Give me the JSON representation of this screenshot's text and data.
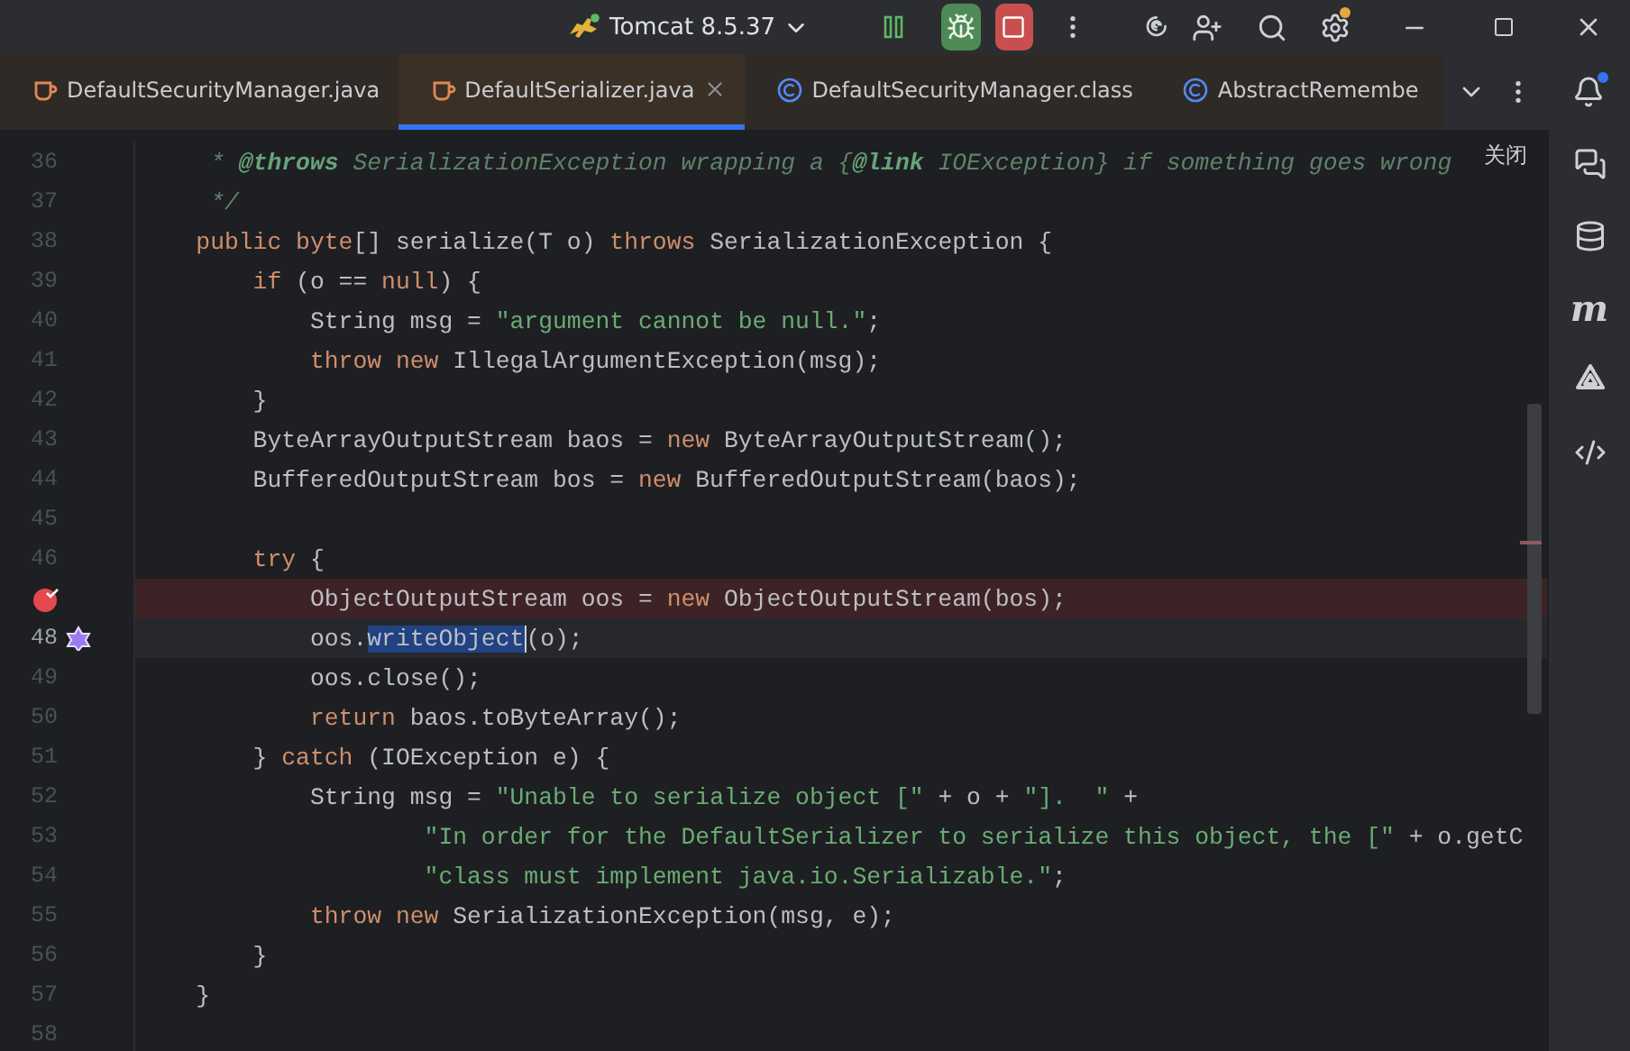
{
  "toolbar": {
    "run_config": "Tomcat 8.5.37"
  },
  "tabs": [
    {
      "label": "DefaultSecurityManager.java",
      "kind": "java",
      "selected": false
    },
    {
      "label": "DefaultSerializer.java",
      "kind": "java",
      "selected": true
    },
    {
      "label": "DefaultSecurityManager.class",
      "kind": "class",
      "selected": false
    },
    {
      "label": "AbstractRemembe",
      "kind": "class",
      "selected": false
    }
  ],
  "close_hint": "关闭",
  "side_tools": {
    "maven_glyph": "m"
  },
  "editor": {
    "lines": [
      {
        "number": "36",
        "breakpoint": false,
        "current": false,
        "segments": [
          {
            "kind": "doc",
            "text": "     * "
          },
          {
            "kind": "doc-tag",
            "text": "@throws"
          },
          {
            "kind": "doc",
            "text": " SerializationException wrapping a {"
          },
          {
            "kind": "doc-tag",
            "text": "@link"
          },
          {
            "kind": "doc",
            "text": " IOException} if something goes wrong"
          }
        ]
      },
      {
        "number": "37",
        "breakpoint": false,
        "current": false,
        "segments": [
          {
            "kind": "doc",
            "text": "     */"
          }
        ]
      },
      {
        "number": "38",
        "breakpoint": false,
        "current": false,
        "segments": [
          {
            "kind": "keyword",
            "text": "    public byte"
          },
          {
            "kind": "plain",
            "text": "[] serialize(T o) "
          },
          {
            "kind": "keyword",
            "text": "throws"
          },
          {
            "kind": "plain",
            "text": " SerializationException {"
          }
        ]
      },
      {
        "number": "39",
        "breakpoint": false,
        "current": false,
        "segments": [
          {
            "kind": "keyword",
            "text": "        if"
          },
          {
            "kind": "plain",
            "text": " (o == "
          },
          {
            "kind": "keyword",
            "text": "null"
          },
          {
            "kind": "plain",
            "text": ") {"
          }
        ]
      },
      {
        "number": "40",
        "breakpoint": false,
        "current": false,
        "segments": [
          {
            "kind": "plain",
            "text": "            String msg = "
          },
          {
            "kind": "string",
            "text": "\"argument cannot be null.\""
          },
          {
            "kind": "plain",
            "text": ";"
          }
        ]
      },
      {
        "number": "41",
        "breakpoint": false,
        "current": false,
        "segments": [
          {
            "kind": "keyword",
            "text": "            throw new"
          },
          {
            "kind": "plain",
            "text": " IllegalArgumentException(msg);"
          }
        ]
      },
      {
        "number": "42",
        "breakpoint": false,
        "current": false,
        "segments": [
          {
            "kind": "plain",
            "text": "        }"
          }
        ]
      },
      {
        "number": "43",
        "breakpoint": false,
        "current": false,
        "segments": [
          {
            "kind": "plain",
            "text": "        ByteArrayOutputStream baos = "
          },
          {
            "kind": "keyword",
            "text": "new"
          },
          {
            "kind": "plain",
            "text": " ByteArrayOutputStream();"
          }
        ]
      },
      {
        "number": "44",
        "breakpoint": false,
        "current": false,
        "segments": [
          {
            "kind": "plain",
            "text": "        BufferedOutputStream bos = "
          },
          {
            "kind": "keyword",
            "text": "new"
          },
          {
            "kind": "plain",
            "text": " BufferedOutputStream(baos);"
          }
        ]
      },
      {
        "number": "45",
        "breakpoint": false,
        "current": false
      },
      {
        "number": "46",
        "breakpoint": false,
        "current": false,
        "segments": [
          {
            "kind": "keyword",
            "text": "        try"
          },
          {
            "kind": "plain",
            "text": " {"
          }
        ]
      },
      {
        "breakpoint": true,
        "current": false,
        "segments": [
          {
            "kind": "plain",
            "text": "            ObjectOutputStream oos = "
          },
          {
            "kind": "keyword",
            "text": "new"
          },
          {
            "kind": "plain",
            "text": " ObjectOutputStream(bos);"
          }
        ]
      },
      {
        "number": "48",
        "breakpoint": false,
        "current": true,
        "segments": [
          {
            "kind": "plain",
            "text": "            oos."
          },
          {
            "kind": "selected",
            "text": "writeObject"
          },
          {
            "kind": "plain",
            "text": "(o);"
          }
        ]
      },
      {
        "number": "49",
        "breakpoint": false,
        "current": false,
        "segments": [
          {
            "kind": "plain",
            "text": "            oos.close();"
          }
        ]
      },
      {
        "number": "50",
        "breakpoint": false,
        "current": false,
        "segments": [
          {
            "kind": "keyword",
            "text": "            return"
          },
          {
            "kind": "plain",
            "text": " baos.toByteArray();"
          }
        ]
      },
      {
        "number": "51",
        "breakpoint": false,
        "current": false,
        "segments": [
          {
            "kind": "plain",
            "text": "        } "
          },
          {
            "kind": "keyword",
            "text": "catch"
          },
          {
            "kind": "plain",
            "text": " (IOException e) {"
          }
        ]
      },
      {
        "number": "52",
        "breakpoint": false,
        "current": false,
        "segments": [
          {
            "kind": "plain",
            "text": "            String msg = "
          },
          {
            "kind": "string",
            "text": "\"Unable to serialize object [\""
          },
          {
            "kind": "plain",
            "text": " + o + "
          },
          {
            "kind": "string",
            "text": "\"].  \""
          },
          {
            "kind": "plain",
            "text": " +"
          }
        ]
      },
      {
        "number": "53",
        "breakpoint": false,
        "current": false,
        "segments": [
          {
            "kind": "string",
            "text": "                    \"In order for the DefaultSerializer to serialize this object, the [\""
          },
          {
            "kind": "plain",
            "text": " + o.getC"
          }
        ]
      },
      {
        "number": "54",
        "breakpoint": false,
        "current": false,
        "segments": [
          {
            "kind": "string",
            "text": "                    \"class must implement java.io.Serializable.\""
          },
          {
            "kind": "plain",
            "text": ";"
          }
        ]
      },
      {
        "number": "55",
        "breakpoint": false,
        "current": false,
        "segments": [
          {
            "kind": "keyword",
            "text": "            throw new"
          },
          {
            "kind": "plain",
            "text": " SerializationException(msg, e);"
          }
        ]
      },
      {
        "number": "56",
        "breakpoint": false,
        "current": false,
        "segments": [
          {
            "kind": "plain",
            "text": "        }"
          }
        ]
      },
      {
        "number": "57",
        "breakpoint": false,
        "current": false,
        "segments": [
          {
            "kind": "plain",
            "text": "    }"
          }
        ]
      },
      {
        "number": "58",
        "breakpoint": false,
        "current": false
      }
    ]
  }
}
